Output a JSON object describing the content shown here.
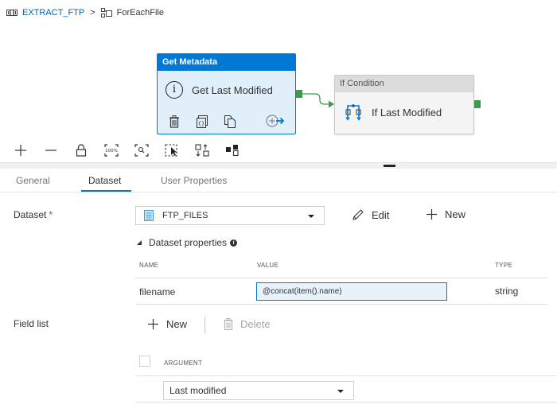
{
  "breadcrumb": {
    "pipeline_icon": "pipeline-icon",
    "pipeline": "EXTRACT_FTP",
    "separator": ">",
    "foreach_icon": "foreach-icon",
    "current": "ForEachFile"
  },
  "canvas": {
    "activities": [
      {
        "type": "Get Metadata",
        "name": "Get Last Modified",
        "icon": "info-icon",
        "actions": [
          "delete-icon",
          "code-icon",
          "copy-icon",
          "add-output-icon"
        ],
        "selected": true,
        "accent_color": "#0078d4"
      },
      {
        "type": "If Condition",
        "name": "If Last Modified",
        "icon": "if-condition-icon",
        "selected": false
      }
    ],
    "connector_color": "#3c9a4b"
  },
  "toolbar": {
    "buttons": [
      "zoom-in",
      "zoom-out",
      "lock",
      "zoom-100",
      "zoom-to-fit",
      "select-mode",
      "auto-align",
      "layout"
    ],
    "zoom_100_label": "100%"
  },
  "tabs": [
    {
      "label": "General",
      "active": false
    },
    {
      "label": "Dataset",
      "active": true
    },
    {
      "label": "User Properties",
      "active": false
    }
  ],
  "form": {
    "dataset_label": "Dataset",
    "required_mark": "*",
    "dataset_value": "FTP_FILES",
    "edit_label": "Edit",
    "new_label": "New",
    "dataset_properties_label": "Dataset properties",
    "dataset_properties_info": "i",
    "properties_table": {
      "headers": [
        "NAME",
        "VALUE",
        "TYPE"
      ],
      "rows": [
        {
          "name": "filename",
          "value": "@concat(item().name)",
          "type": "string"
        }
      ]
    },
    "field_list_label": "Field list",
    "field_new_label": "New",
    "field_delete_label": "Delete",
    "field_table": {
      "header": "ARGUMENT",
      "rows": [
        {
          "argument": "Last modified"
        }
      ]
    }
  }
}
